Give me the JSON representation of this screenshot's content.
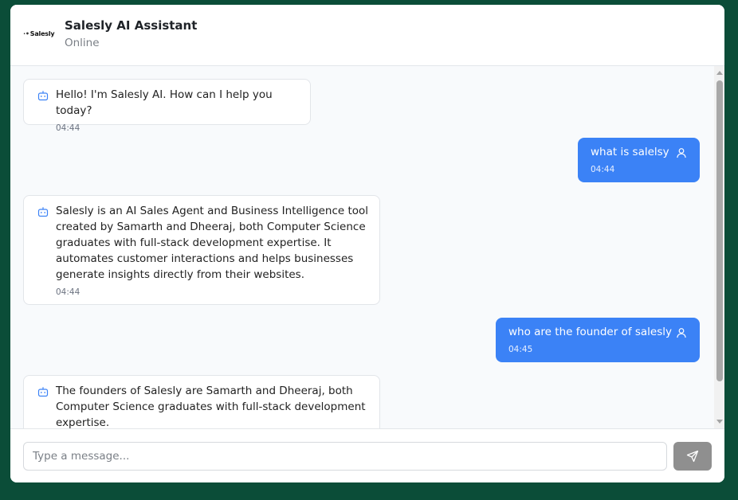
{
  "header": {
    "logo_text": "Salesly",
    "logo_mark": "∙•",
    "title": "Salesly AI Assistant",
    "status": "Online"
  },
  "messages": [
    {
      "sender": "bot",
      "icon": "bot-icon",
      "text": "Hello! I'm Salesly AI. How can I help you today?",
      "time": "04:44"
    },
    {
      "sender": "user",
      "icon": "user-icon",
      "text": "what is salelsy",
      "time": "04:44"
    },
    {
      "sender": "bot",
      "icon": "bot-icon",
      "text": "Salesly is an AI Sales Agent and Business Intelligence tool\ncreated by Samarth and Dheeraj, both Computer Science\ngraduates with full-stack development expertise. It\nautomates customer interactions and helps businesses\ngenerate insights directly from their websites.",
      "time": "04:44"
    },
    {
      "sender": "user",
      "icon": "user-icon",
      "text": "who are the founder of salesly",
      "time": "04:45"
    },
    {
      "sender": "bot",
      "icon": "bot-icon",
      "text": "The founders of Salesly are Samarth and Dheeraj, both\nComputer Science graduates with full-stack development\nexpertise.",
      "time": ""
    }
  ],
  "composer": {
    "placeholder": "Type a message...",
    "send_icon": "send-icon"
  },
  "colors": {
    "page_background": "#0b4d38",
    "user_bubble": "#3b82f6",
    "send_button": "#8f8f8f"
  }
}
